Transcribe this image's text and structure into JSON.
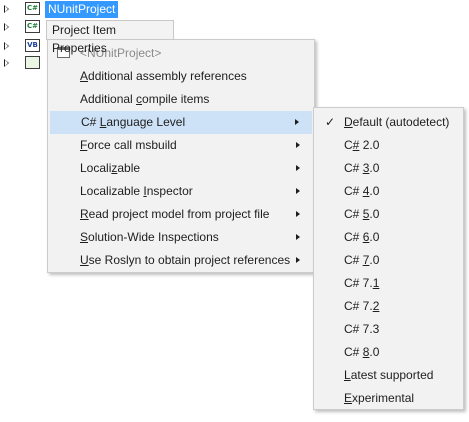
{
  "tree": {
    "items": [
      {
        "icon": "csharp-project-icon",
        "icon_text": "C#",
        "label": "NUnitProject"
      },
      {
        "icon": "csharp-project-icon",
        "icon_text": "C#",
        "label": ""
      },
      {
        "icon": "vb-project-icon",
        "icon_text": "VB",
        "label": ""
      },
      {
        "icon": "test-project-icon",
        "icon_text": "",
        "label": ""
      }
    ]
  },
  "header": {
    "label": "Project Item Properties"
  },
  "main_menu": {
    "project_label": "<NUnitProject>",
    "items": [
      {
        "pre": "",
        "key": "A",
        "post": "dditional assembly references",
        "submenu": false
      },
      {
        "pre": "Additional ",
        "key": "c",
        "post": "ompile items",
        "submenu": false
      },
      {
        "pre": "C# ",
        "key": "L",
        "post": "anguage Level",
        "submenu": true
      },
      {
        "pre": "",
        "key": "F",
        "post": "orce call msbuild",
        "submenu": true
      },
      {
        "pre": "Locali",
        "key": "z",
        "post": "able",
        "submenu": true
      },
      {
        "pre": "Localizable ",
        "key": "I",
        "post": "nspector",
        "submenu": true
      },
      {
        "pre": "",
        "key": "R",
        "post": "ead project model from project file",
        "submenu": true
      },
      {
        "pre": "",
        "key": "S",
        "post": "olution-Wide Inspections",
        "submenu": true
      },
      {
        "pre": "",
        "key": "U",
        "post": "se Roslyn to obtain project references",
        "submenu": true
      }
    ]
  },
  "language_menu": {
    "check": "✓",
    "items": [
      {
        "pre": "",
        "key": "D",
        "post": "efault (autodetect)",
        "checked": true
      },
      {
        "pre": "C",
        "key": "#",
        "post": " 2.0",
        "checked": false
      },
      {
        "pre": "C# ",
        "key": "3",
        "post": ".0",
        "checked": false
      },
      {
        "pre": "C# ",
        "key": "4",
        "post": ".0",
        "checked": false
      },
      {
        "pre": "C# ",
        "key": "5",
        "post": ".0",
        "checked": false
      },
      {
        "pre": "C# ",
        "key": "6",
        "post": ".0",
        "checked": false
      },
      {
        "pre": "C# ",
        "key": "7",
        "post": ".0",
        "checked": false
      },
      {
        "pre": "C# 7.",
        "key": "1",
        "post": "",
        "checked": false
      },
      {
        "pre": "C# 7.",
        "key": "2",
        "post": "",
        "checked": false
      },
      {
        "pre": "C# 7.3",
        "key": "",
        "post": "",
        "checked": false
      },
      {
        "pre": "C# ",
        "key": "8",
        "post": ".0",
        "checked": false
      },
      {
        "pre": "",
        "key": "L",
        "post": "atest supported",
        "checked": false
      },
      {
        "pre": "",
        "key": "E",
        "post": "xperimental",
        "checked": false
      }
    ]
  },
  "colors": {
    "selection": "#3399ff",
    "menu_bg": "#f2f2f2",
    "highlight": "#cde1f7"
  }
}
